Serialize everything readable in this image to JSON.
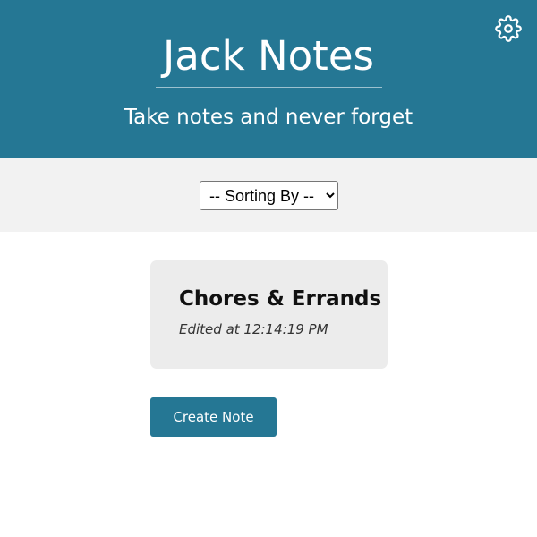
{
  "header": {
    "title": "Jack Notes",
    "subtitle": "Take notes and never forget",
    "settings_icon": "gear-icon",
    "background_color": "#257794"
  },
  "sort": {
    "selected": "-- Sorting By --",
    "options": [
      "-- Sorting By --"
    ]
  },
  "notes": [
    {
      "title": "Chores & Errands",
      "edited": "Edited at 12:14:19 PM"
    }
  ],
  "actions": {
    "create_label": "Create Note"
  },
  "colors": {
    "accent": "#257794",
    "sort_bar": "#f2f2f2",
    "card": "#ececec"
  }
}
